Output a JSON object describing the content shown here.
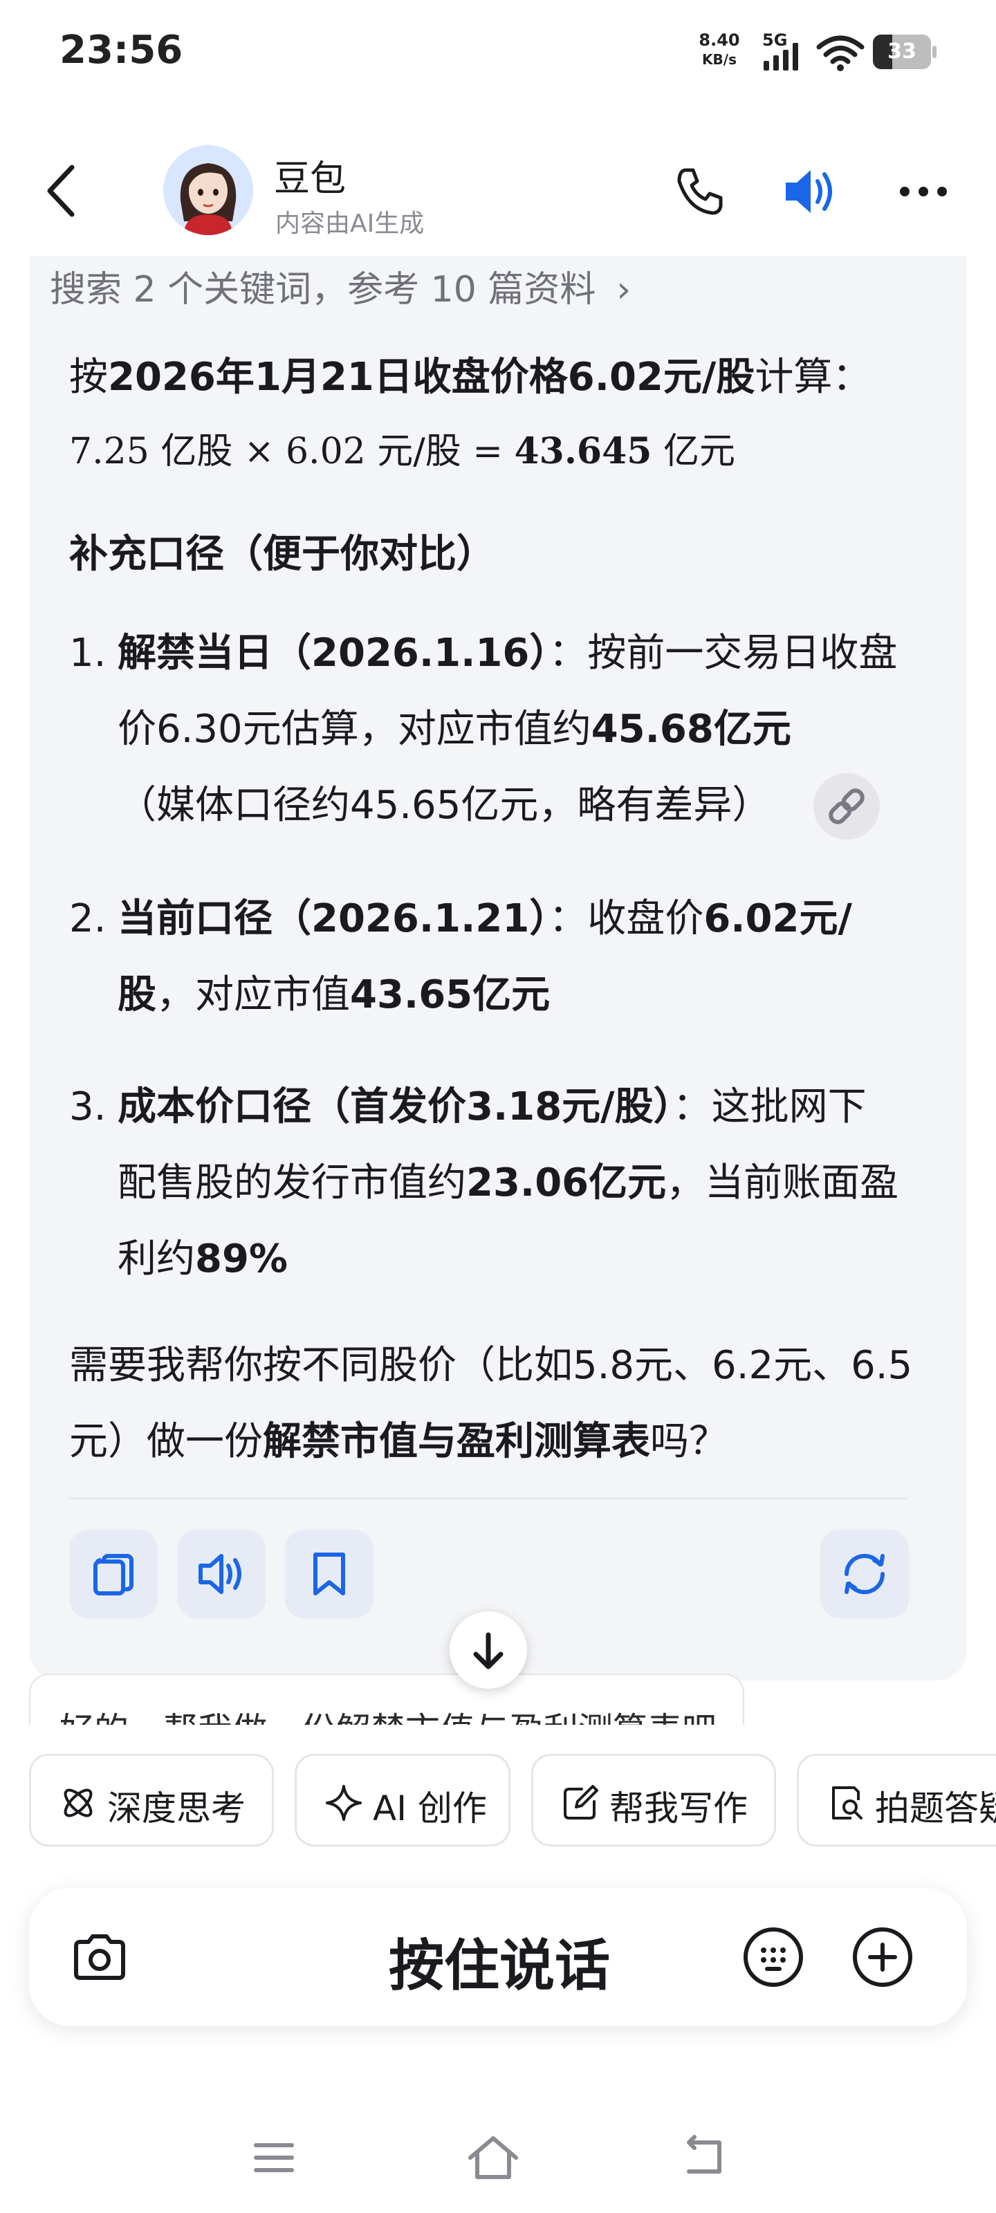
{
  "status_bar": {
    "time": "23:56",
    "net_speed_value": "8.40",
    "net_speed_unit": "KB/s",
    "network": "5G",
    "battery_level": "33",
    "battery_fraction": 0.33
  },
  "header": {
    "bot_name": "豆包",
    "bot_subtitle": "内容由AI生成",
    "icons": [
      "back-arrow",
      "phone",
      "speaker",
      "more"
    ]
  },
  "message": {
    "search_ref": "搜索 2 个关键词，参考 10 篇资料",
    "calc_prefix": "按",
    "calc_bold": "2026年1月21日收盘价格6.02元/股",
    "calc_suffix": "计算：",
    "formula": {
      "a": "7.25",
      "a_unit": "亿股",
      "times": "×",
      "b": "6.02",
      "b_unit": "元/股",
      "equals": "=",
      "result": "43.645",
      "result_unit": "亿元"
    },
    "section_title": "补充口径（便于你对比）",
    "items": [
      {
        "num": "1.",
        "bold": "解禁当日（2026.1.16）",
        "text1": "：按前一交易日收盘价6.30元估算，对应市值约",
        "bold2": "45.68亿元",
        "text2": "（媒体口径约45.65亿元，略有差异）"
      },
      {
        "num": "2.",
        "bold": "当前口径（2026.1.21）",
        "text1": "：收盘价",
        "bold2": "6.02元/股",
        "text2": "，对应市值",
        "bold3": "43.65亿元"
      },
      {
        "num": "3.",
        "bold": "成本价口径（首发价3.18元/股）",
        "text1": "：这批网下配售股的发行市值约",
        "bold2": "23.06亿元",
        "text2": "，当前账面盈利约",
        "bold3": "89%"
      }
    ],
    "closing_prefix": "需要我帮你按不同股价（比如5.8元、6.2元、6.5元）做一份",
    "closing_bold": "解禁市值与盈利测算表",
    "closing_suffix": "吗？"
  },
  "quote_chip_text": "好的，帮我做一份解禁市值与盈利测算表吧",
  "shortcuts": [
    {
      "label": "深度思考",
      "icon": "atom-icon"
    },
    {
      "label": "AI 创作",
      "icon": "sparkle-icon"
    },
    {
      "label": "帮我写作",
      "icon": "edit-icon"
    },
    {
      "label": "拍题答疑",
      "icon": "doc-search-icon"
    }
  ],
  "input_bar": {
    "hold_to_talk": "按住说话"
  },
  "colors": {
    "accent_blue": "#1a66e6",
    "card_bg": "#f4f5f7",
    "action_bg": "#e6ebf5"
  }
}
